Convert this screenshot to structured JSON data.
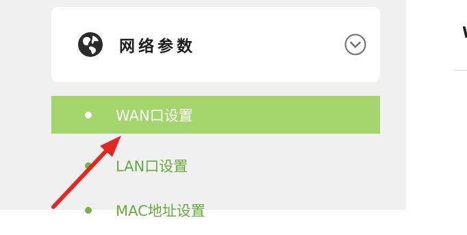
{
  "content": {
    "header_text": "W"
  },
  "sidebar": {
    "group": {
      "title": "网络参数",
      "icon": "globe-icon",
      "expand_icon": "chevron-down-circle-icon"
    },
    "items": [
      {
        "label": "WAN口设置",
        "active": true
      },
      {
        "label": "LAN口设置",
        "active": false
      },
      {
        "label": "MAC地址设置",
        "active": false
      }
    ]
  },
  "colors": {
    "active_bg": "#a3d56c",
    "inactive_text": "#68a83c",
    "sidebar_bg": "#f0f0f0",
    "arrow": "#e3261f"
  }
}
